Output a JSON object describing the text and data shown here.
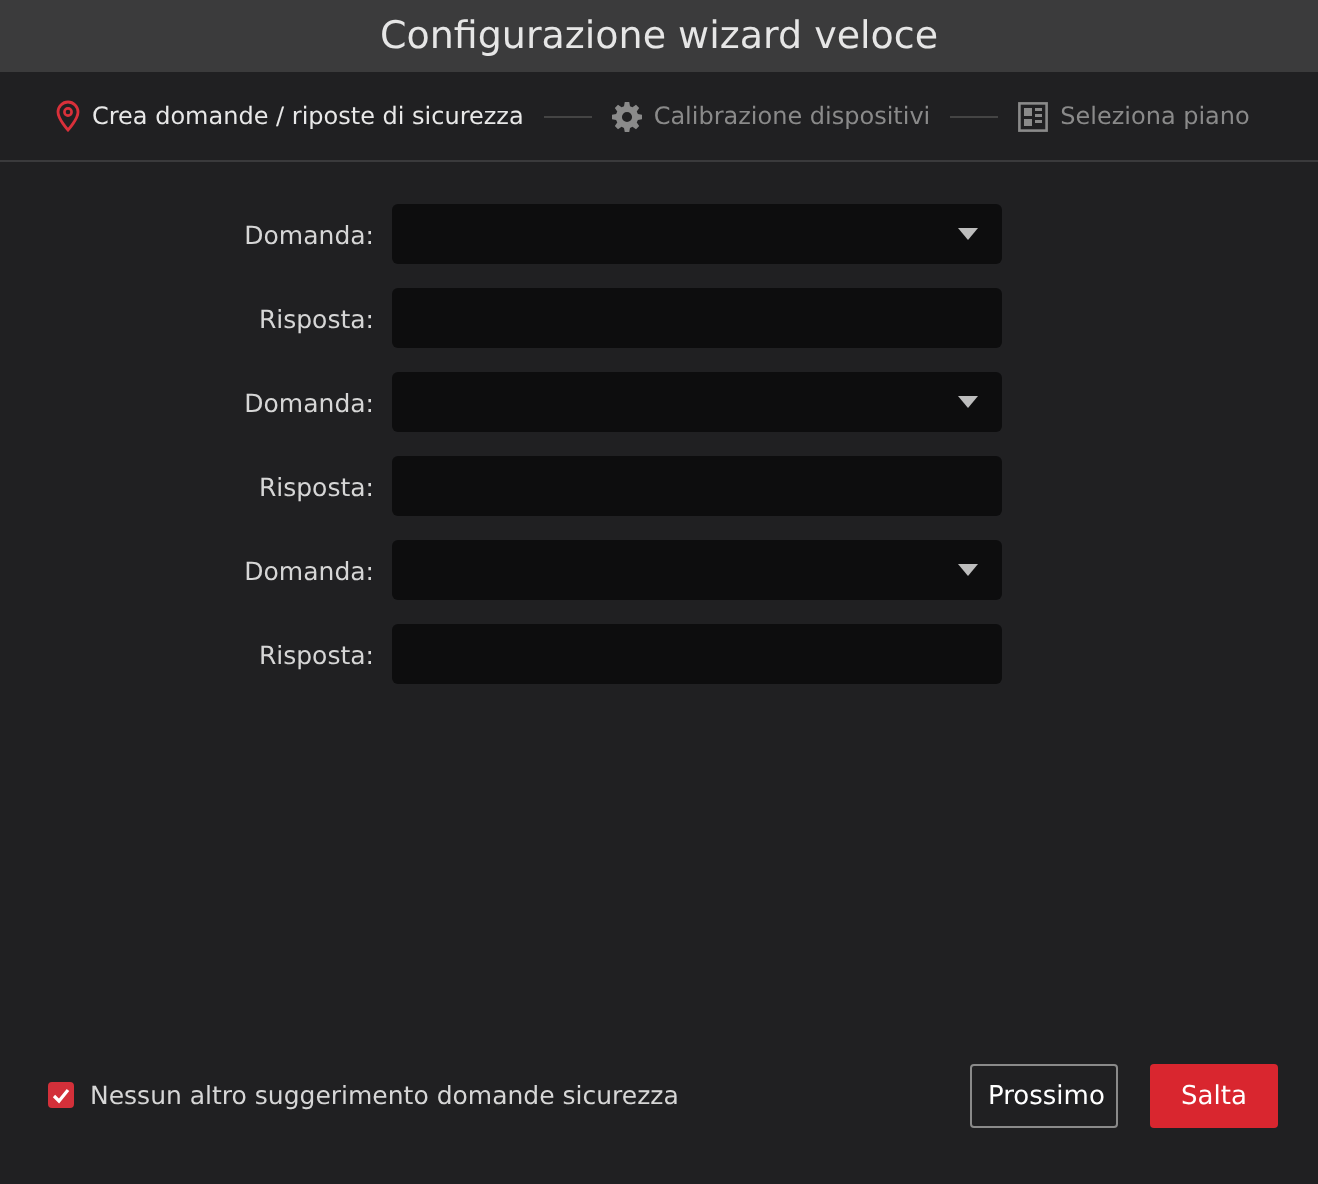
{
  "window": {
    "title": "Configurazione wizard veloce"
  },
  "steps": [
    {
      "label": "Crea domande / riposte di sicurezza",
      "selected": true
    },
    {
      "label": "Calibrazione dispositivi",
      "selected": false
    },
    {
      "label": "Seleziona piano",
      "selected": false
    }
  ],
  "fields": [
    {
      "label": "Domanda:",
      "kind": "dropdown"
    },
    {
      "label": "Risposta:",
      "kind": "text"
    },
    {
      "label": "Domanda:",
      "kind": "dropdown"
    },
    {
      "label": "Risposta:",
      "kind": "text"
    },
    {
      "label": "Domanda:",
      "kind": "dropdown"
    },
    {
      "label": "Risposta:",
      "kind": "text"
    }
  ],
  "option": {
    "label": "Nessun altro suggerimento domande sicurezza",
    "checked": true
  },
  "buttons": [
    {
      "label": "Prossimo",
      "kind": "outline"
    },
    {
      "label": "Salta",
      "kind": "primary"
    }
  ]
}
